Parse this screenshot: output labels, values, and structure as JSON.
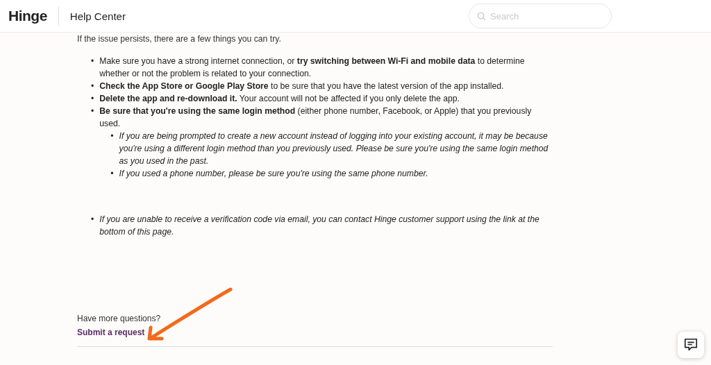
{
  "header": {
    "logo": "Hinge",
    "title": "Help Center",
    "search": {
      "placeholder": "Search"
    }
  },
  "intro": "If the issue persists, there are a few things you can try.",
  "tips": [
    {
      "kind": "plain",
      "marker": "•",
      "text": "Make sure you have a strong internet connection, or **try switching between Wi-Fi and mobile data** to determine whether or not the problem is related to your connection."
    },
    {
      "kind": "plain",
      "marker": "•",
      "text": "**Check the App Store or Google Play Store** to be sure that you have the latest version of the app installed."
    },
    {
      "kind": "plain",
      "marker": "•",
      "text": "**Delete the app and re-download it.** Your account will not be affected if you only delete the app."
    },
    {
      "kind": "plain",
      "marker": "•",
      "text": "**Be sure that you're using the same login method** (either phone number, Facebook, or Apple) that you previously used.",
      "children": [
        {
          "kind": "note",
          "marker": "•",
          "text": "If you are being prompted to create a new account instead of logging into your existing account, it may be because you're using a different login method than you previously used. Please be sure you're using the same login method as you used in the past."
        },
        {
          "kind": "note",
          "marker": "•",
          "text": "If you used a phone number, please be sure you're using the same phone number."
        }
      ]
    }
  ],
  "more_tips": [
    {
      "kind": "note",
      "marker": "•",
      "text": "If you are unable to receive a verification code via email, you can contact Hinge customer support using the link at the bottom of this page."
    }
  ],
  "footer": {
    "prompt": "Have more questions?",
    "link": "Submit a request"
  }
}
